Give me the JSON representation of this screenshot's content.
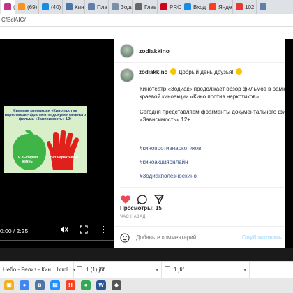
{
  "browser": {
    "tabs": [
      {
        "label": "(",
        "icon": "instagram-icon",
        "color": "#c13584",
        "active": true
      },
      {
        "label": "(69)",
        "icon": "odnoklassniki-icon",
        "color": "#f7931e"
      },
      {
        "label": "(40)",
        "icon": "mail-icon",
        "color": "#168de2"
      },
      {
        "label": "Кин",
        "icon": "vk-icon",
        "color": "#4a76a8"
      },
      {
        "label": "Плат",
        "icon": "page-icon",
        "color": "#5f7fa8"
      },
      {
        "label": "Зоди",
        "icon": "page-icon",
        "color": "#7a8fa8"
      },
      {
        "label": "Глав",
        "icon": "gear-icon",
        "color": "#666666"
      },
      {
        "label": "PRO",
        "icon": "k-icon",
        "color": "#d0021b"
      },
      {
        "label": "Вход",
        "icon": "mail-icon",
        "color": "#168de2"
      },
      {
        "label": "Янде",
        "icon": "yandex-icon",
        "color": "#fc3f1d"
      },
      {
        "label": "102",
        "icon": "yandex-icon",
        "color": "#e53935"
      },
      {
        "label": "Д",
        "icon": "page-icon",
        "color": "#5f7fa8"
      }
    ],
    "address": "CfEclAIC/"
  },
  "video": {
    "poster_title": "Краевая киноакция «Кино против наркотиков» фрагменты документального фильма «Зависимость» 12+",
    "apple_text": "Я выбираю жизнь!",
    "hand_text": "Нет наркотикам!",
    "time": "0:00 / 2:25",
    "progress": 0
  },
  "post": {
    "username": "zodiakkino",
    "greeting": "Добрый день друзья!",
    "body_lines": [
      "Кинотеатр «Зодиак» продолжает  обзор фильмов  в рамка",
      "краевой киноакции «Кино против наркотиков».",
      "",
      "Сегодня представляем  фрагменты  документального филь",
      "«Зависимость» 12+."
    ],
    "hashtags": [
      "#кинопротивнаркотиков",
      "#киноакцияонлайн",
      "#Зодиакполезноекино"
    ],
    "views": "Просмотры: 15",
    "ago": "ЧАС НАЗАД",
    "comment_placeholder": "Добавьте комментарий...",
    "publish_label": "Опубликовать",
    "colors": {
      "hashtag": "#385185",
      "heart": "#ed4956"
    }
  },
  "downloads": [
    {
      "name": "Небо - Релиз - Кин....html"
    },
    {
      "name": "1 (1).jfif"
    },
    {
      "name": "1.jfif"
    }
  ],
  "taskbar": [
    {
      "icon": "explorer-icon",
      "color": "#f2b01e",
      "label": "▣"
    },
    {
      "icon": "chrome-icon",
      "color": "#4285f4",
      "label": "●"
    },
    {
      "icon": "vk-icon",
      "color": "#4a76a8",
      "label": "в"
    },
    {
      "icon": "explorer-icon",
      "color": "#1e90ff",
      "label": "▤"
    },
    {
      "icon": "yandex-icon",
      "color": "#fc3f1d",
      "label": "Я"
    },
    {
      "icon": "chrome-icon",
      "color": "#34a853",
      "label": "●"
    },
    {
      "icon": "word-icon",
      "color": "#2b579a",
      "label": "W"
    },
    {
      "icon": "app-icon",
      "color": "#555555",
      "label": "◆"
    }
  ]
}
